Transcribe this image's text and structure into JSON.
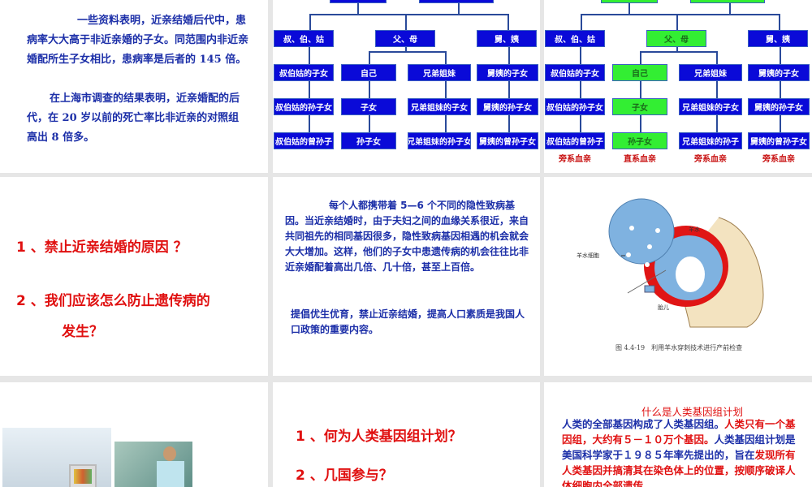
{
  "slides": {
    "s1": {
      "p1": "一些资料表明，近亲结婚后代中，患病率大大高于非近亲婚的子女。同范围内非近亲婚配所生子女相比，患病率是后者的 145 倍。",
      "p2": "在上海市调查的结果表明，近亲婚配的后代，在 20 岁以前的死亡率比非近亲的对照组高出 8 倍多。"
    },
    "chart": {
      "row1": [
        "叔、伯、姑",
        "父、母",
        "舅、姨"
      ],
      "row2": [
        "叔伯姑的子女",
        "自己",
        "兄弟姐妹",
        "舅姨的子女"
      ],
      "row3": [
        "叔伯姑的孙子女",
        "子女",
        "兄弟姐妹的子女",
        "舅姨的孙子女"
      ],
      "row4": [
        "叔伯姑的曾孙子",
        "孙子女",
        "兄弟姐妹的孙子女",
        "舅姨的曾孙子女"
      ],
      "row4_s3": [
        "叔伯姑的曾孙子",
        "孙子女",
        "兄弟姐妹的孙子",
        "舅姨的曾孙子女"
      ],
      "kin": [
        "旁系血亲",
        "直系血亲",
        "旁系血亲",
        "旁系血亲"
      ]
    },
    "s4": {
      "q1": "1 、禁止近亲结婚的原因 ？",
      "q2a": "2 、我们应该怎么防止遗传病的",
      "q2b": "发生？"
    },
    "s5": {
      "p1": "每个人都携带着 5—6 个不同的隐性致病基因。当近亲结婚时，由于夫妇之间的血缘关系很近，来自共同祖先的相同基因很多，隐性致病基因相遇的机会就会大大增加。这样，他们的子女中患遗传病的机会往往比非近亲婚配着高出几倍、几十倍，甚至上百倍。",
      "p2": "提倡优生优育，禁止近亲结婚，提高人口素质是我国人口政策的重要内容。"
    },
    "s6": {
      "label_cells": "羊水细胞",
      "label_fluid": "羊水",
      "label_fetus": "胎儿",
      "caption": "图 4.4-19　利用羊水穿刺技术进行产前检查"
    },
    "s8": {
      "q1": "1 、何为人类基因组计划？",
      "q2": "2 、几国参与？"
    },
    "s9": {
      "title": "什么是人类基因组计划",
      "t1": "人类的全部基因构成了人类基因组。",
      "t2": "人类只有一个基因组，大约有５－１０万个基因。",
      "t3": "人类基因组计划是美国科学家于１９８５年率先提出的，旨在",
      "t4": "发现所有人类基因并搞清其在染色体上的位置，按顺序破译人体细胞内全部遗传"
    }
  },
  "colors": {
    "blue_box": "#0a0ad8",
    "green_box": "#33ee33",
    "red": "#e01010",
    "text_blue": "#1c2fa8"
  }
}
